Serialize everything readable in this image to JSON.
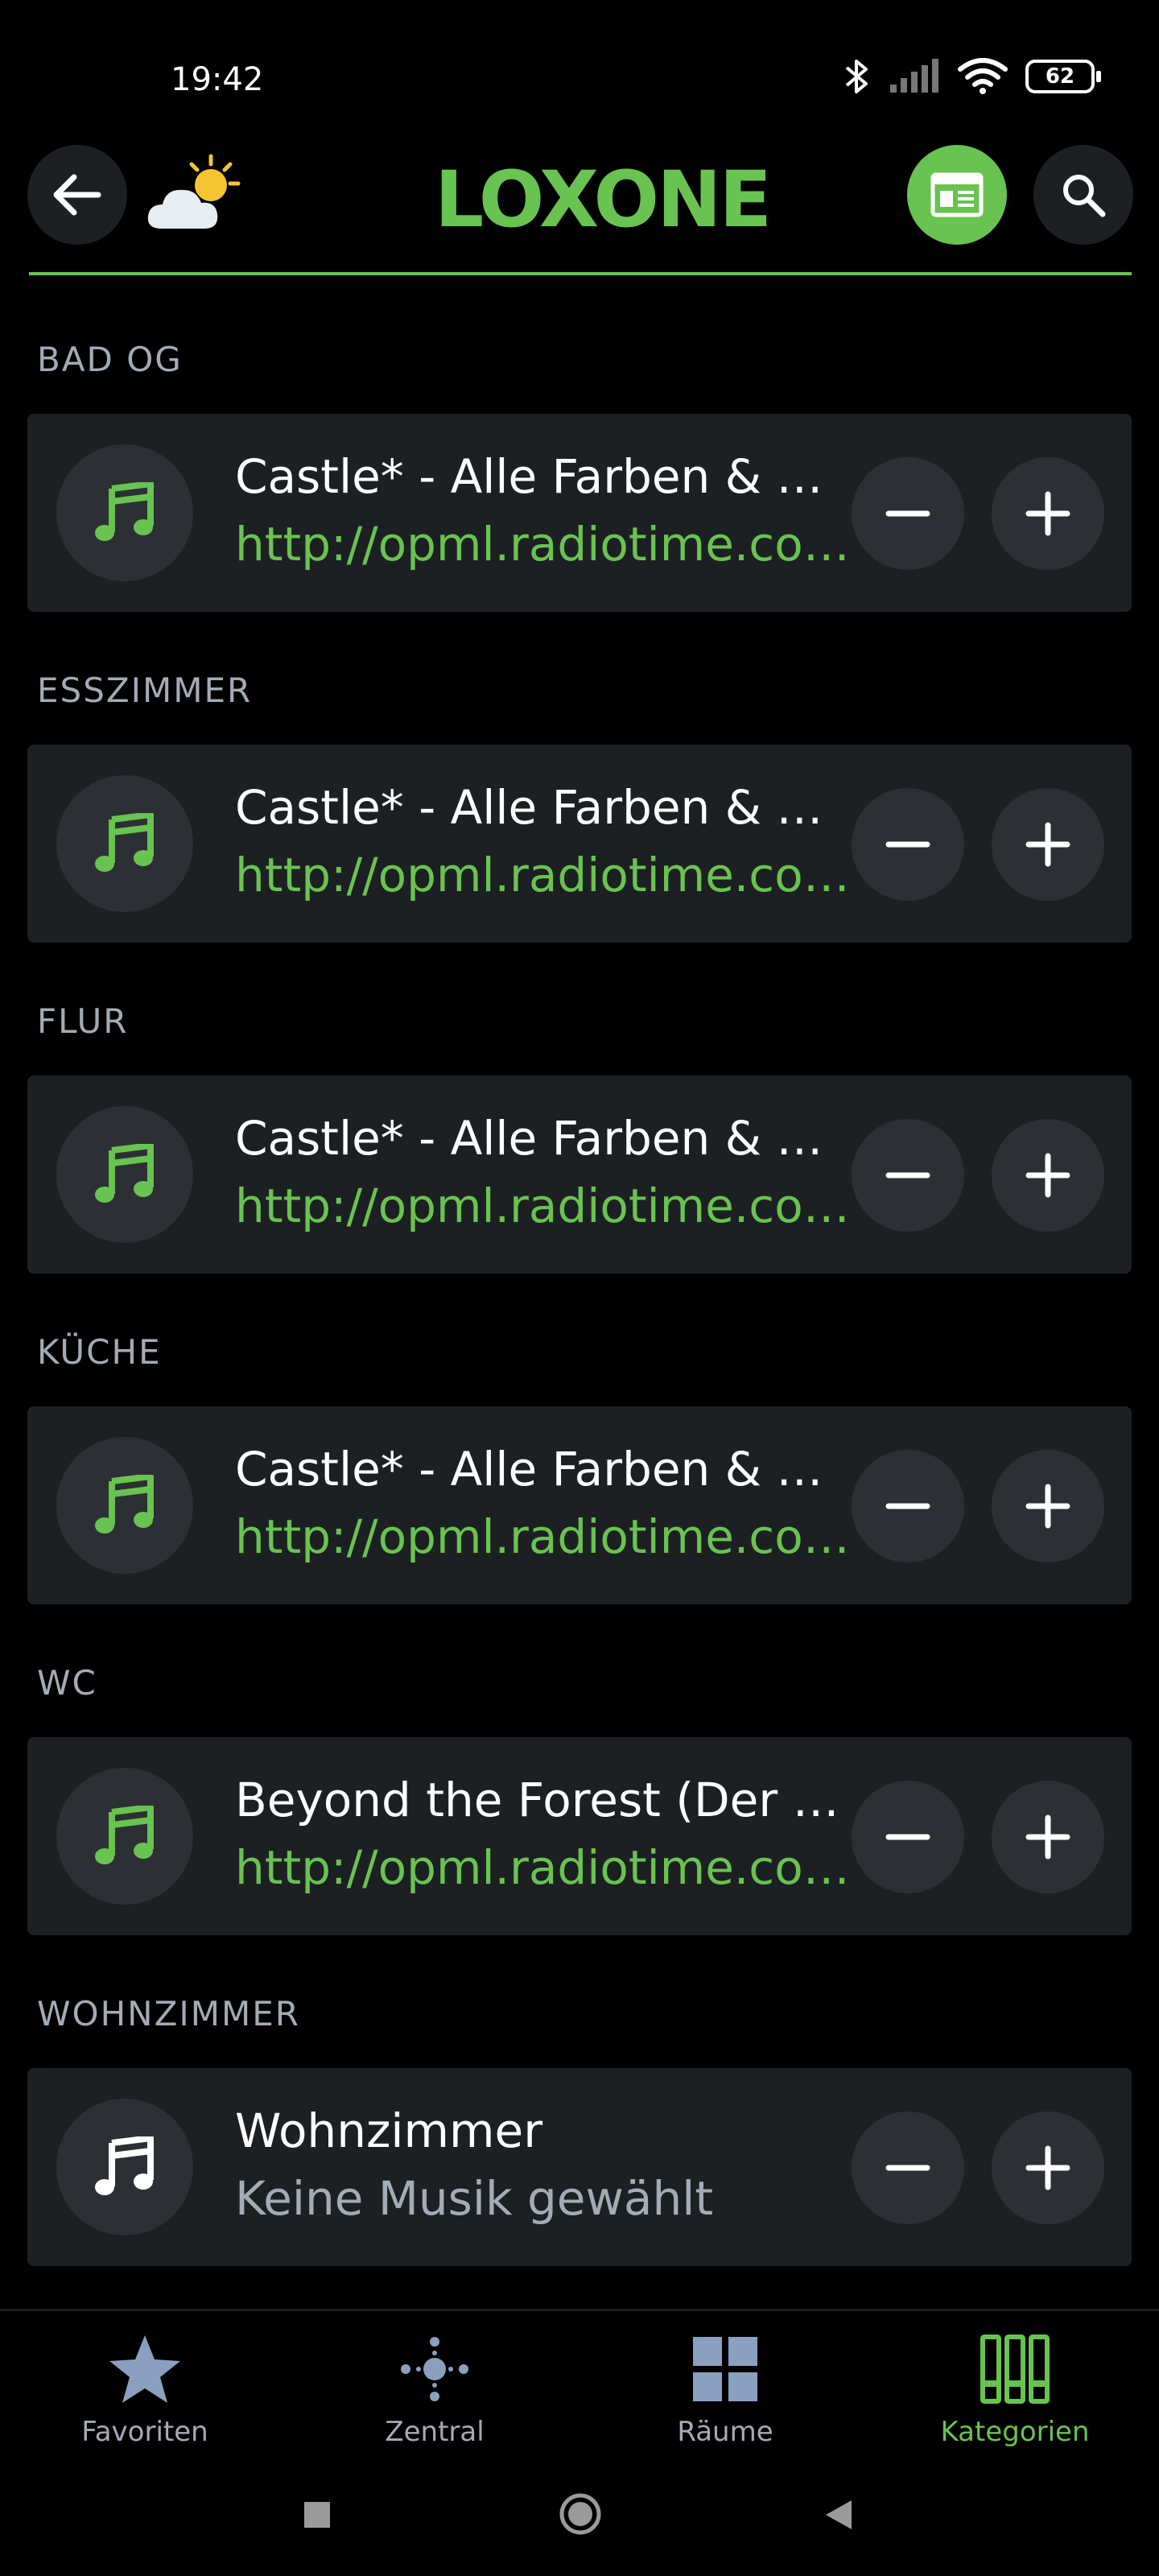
{
  "status_bar": {
    "time": "19:42",
    "battery": "62"
  },
  "header": {
    "logo": "LOXONE"
  },
  "rooms": [
    {
      "label": "BAD OG",
      "title": "Castle* - Alle Farben & Graham Candy",
      "subtitle": "http://opml.radiotime.com/Tune.ashx",
      "playing": true
    },
    {
      "label": "ESSZIMMER",
      "title": "Castle* - Alle Farben & Graham Candy",
      "subtitle": "http://opml.radiotime.com/Tune.ashx",
      "playing": true
    },
    {
      "label": "FLUR",
      "title": "Castle* - Alle Farben & Graham Candy",
      "subtitle": "http://opml.radiotime.com/Tune.ashx",
      "playing": true
    },
    {
      "label": "KÜCHE",
      "title": "Castle* - Alle Farben & Graham Candy",
      "subtitle": "http://opml.radiotime.com/Tune.ashx",
      "playing": true
    },
    {
      "label": "WC",
      "title": "Beyond the Forest (Der Wald)",
      "subtitle": "http://opml.radiotime.com/Tune.ashx",
      "playing": true
    },
    {
      "label": "WOHNZIMMER",
      "title": "Wohnzimmer",
      "subtitle": "Keine Musik gewählt",
      "playing": false
    }
  ],
  "bottom_nav": [
    {
      "label": "Favoriten",
      "icon": "star-icon",
      "active": false
    },
    {
      "label": "Zentral",
      "icon": "central-icon",
      "active": false
    },
    {
      "label": "Räume",
      "icon": "rooms-grid-icon",
      "active": false
    },
    {
      "label": "Kategorien",
      "icon": "categories-icon",
      "active": true
    }
  ],
  "colors": {
    "accent": "#69c350",
    "card": "#1d2023",
    "button": "#2c3034",
    "muted": "#a3acb5"
  }
}
